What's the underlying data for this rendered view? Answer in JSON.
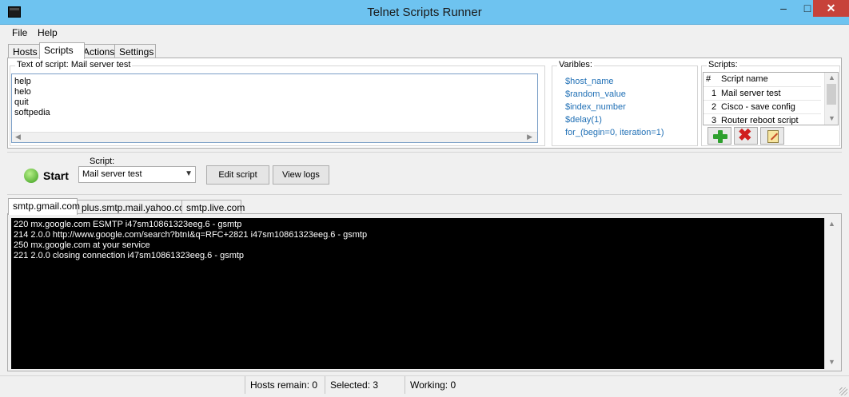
{
  "window": {
    "title": "Telnet Scripts Runner",
    "min": "–",
    "max": "□",
    "close": "✕"
  },
  "menu": [
    "File",
    "Help"
  ],
  "tabs_top": [
    "Hosts",
    "Scripts",
    "Actions",
    "Settings"
  ],
  "script_text": {
    "label": "Text of script: Mail server test",
    "lines": [
      "help",
      "helo",
      "quit",
      "softpedia"
    ]
  },
  "variables": {
    "label": "Varibles:",
    "items": [
      "$host_name",
      "$random_value",
      "$index_number",
      "$delay(1)",
      "for_(begin=0, iteration=1)"
    ]
  },
  "scripts_list": {
    "label": "Scripts:",
    "col_num": "#",
    "col_name": "Script name",
    "rows": [
      {
        "num": "1",
        "name": "Mail server test"
      },
      {
        "num": "2",
        "name": "Cisco - save config"
      },
      {
        "num": "3",
        "name": "Router reboot script"
      }
    ]
  },
  "controls": {
    "start": "Start",
    "script_label": "Script:",
    "selected_script": "Mail server test",
    "edit_script": "Edit script",
    "view_logs": "View logs"
  },
  "tabs_hosts": [
    "smtp.gmail.com",
    "plus.smtp.mail.yahoo.com",
    "smtp.live.com"
  ],
  "log": [
    "220 mx.google.com ESMTP i47sm10861323eeg.6 - gsmtp",
    "214 2.0.0 http://www.google.com/search?btnI&q=RFC+2821 i47sm10861323eeg.6 - gsmtp",
    "250 mx.google.com at your service",
    "221 2.0.0 closing connection i47sm10861323eeg.6 - gsmtp"
  ],
  "status": {
    "hosts_remain": "Hosts remain: 0",
    "selected": "Selected: 3",
    "working": "Working: 0"
  }
}
